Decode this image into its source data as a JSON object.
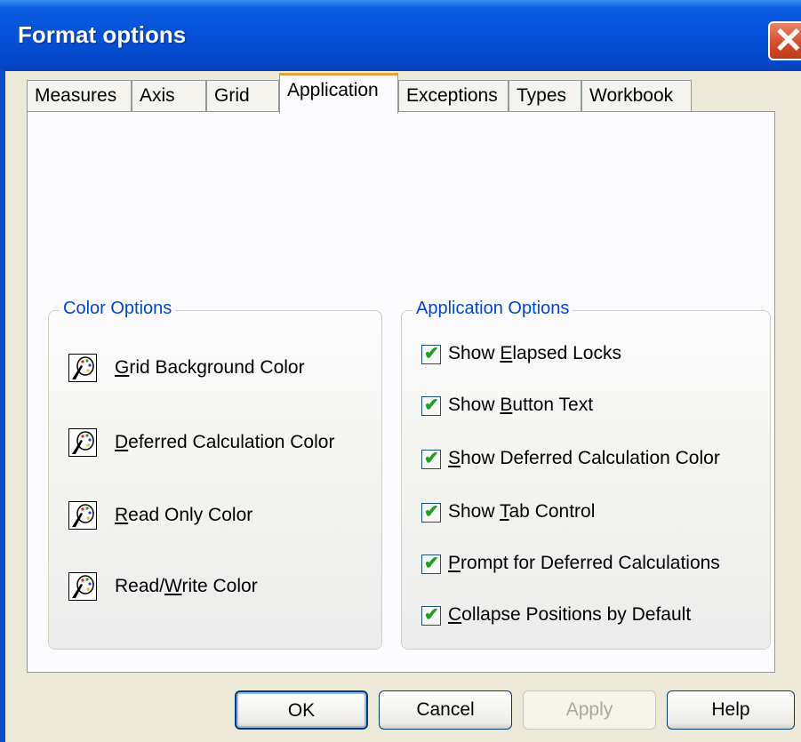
{
  "window": {
    "title": "Format options"
  },
  "tabs": [
    {
      "label": "Measures"
    },
    {
      "label": "Axis"
    },
    {
      "label": "Grid"
    },
    {
      "label": "Application",
      "active": true
    },
    {
      "label": "Exceptions"
    },
    {
      "label": "Types"
    },
    {
      "label": "Workbook"
    }
  ],
  "color_options": {
    "title": "Color Options",
    "items": [
      {
        "pre": "",
        "key": "G",
        "post": "rid Background Color"
      },
      {
        "pre": "",
        "key": "D",
        "post": "eferred Calculation Color"
      },
      {
        "pre": "",
        "key": "R",
        "post": "ead Only Color"
      },
      {
        "pre": "Read/",
        "key": "W",
        "post": "rite Color"
      }
    ]
  },
  "application_options": {
    "title": "Application Options",
    "items": [
      {
        "pre": "Show ",
        "key": "E",
        "post": "lapsed Locks",
        "checked": true
      },
      {
        "pre": "Show ",
        "key": "B",
        "post": "utton Text",
        "checked": true
      },
      {
        "pre": "",
        "key": "S",
        "post": "how Deferred Calculation Color",
        "checked": true
      },
      {
        "pre": "Show ",
        "key": "T",
        "post": "ab Control",
        "checked": true
      },
      {
        "pre": "",
        "key": "P",
        "post": "rompt for Deferred Calculations",
        "checked": true
      },
      {
        "pre": "",
        "key": "C",
        "post": "ollapse Positions by Default",
        "checked": true
      }
    ]
  },
  "buttons": {
    "ok": "OK",
    "cancel": "Cancel",
    "apply": "Apply",
    "help": "Help"
  },
  "icons": {
    "close": "close-icon",
    "palette": "palette-icon",
    "check": "checkmark-icon"
  },
  "colors": {
    "titlebar": "#0551d8",
    "group_title": "#0046d5",
    "active_tab_accent": "#e3a43c",
    "check": "#21a121"
  }
}
